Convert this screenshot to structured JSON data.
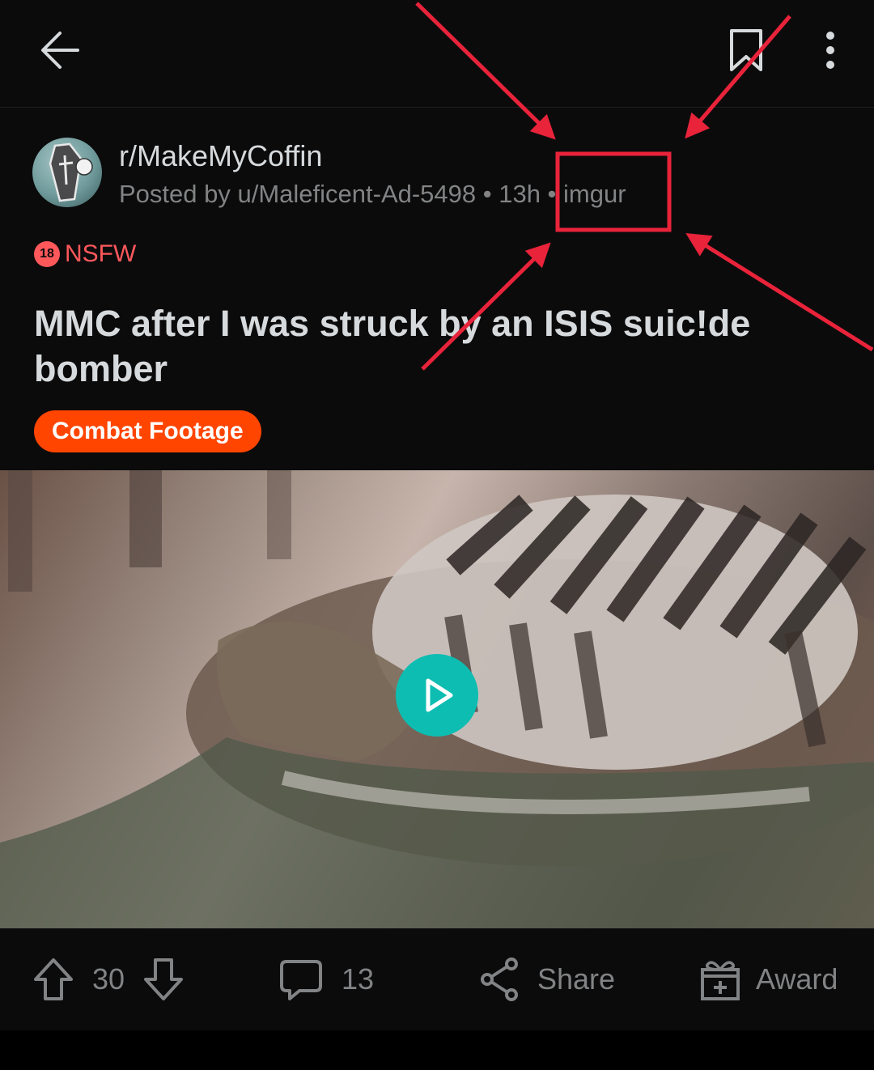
{
  "post": {
    "subreddit": "r/MakeMyCoffin",
    "meta": "Posted by u/Maleficent-Ad-5498 • 13h • imgur",
    "nsfw_label": "NSFW",
    "nsfw_badge": "18",
    "title": "MMC after I was struck by an ISIS suic!de bomber",
    "flair": "Combat Footage"
  },
  "actions": {
    "upvotes": "30",
    "comments": "13",
    "share": "Share",
    "award": "Award"
  },
  "icons": {
    "back": "back-arrow-icon",
    "save": "bookmark-icon",
    "more": "more-vertical-icon",
    "play": "play-icon",
    "upvote": "upvote-arrow-icon",
    "downvote": "downvote-arrow-icon",
    "comment": "comment-bubble-icon",
    "share": "share-icon",
    "award": "gift-icon"
  },
  "colors": {
    "background": "#0b0b0c",
    "nsfw": "#ff585b",
    "flair": "#ff4500",
    "play": "#0dbdb2",
    "annotation": "#e8233a"
  }
}
